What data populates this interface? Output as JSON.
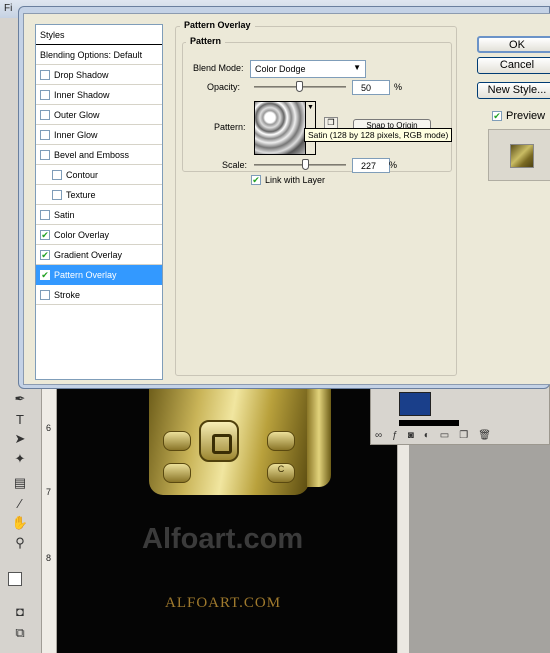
{
  "window": {
    "title": "Fi"
  },
  "dialog": {
    "styles_header": "Styles",
    "blending_options": "Blending Options: Default",
    "layer_styles": [
      {
        "label": "Drop Shadow",
        "checked": false,
        "indent": false
      },
      {
        "label": "Inner Shadow",
        "checked": false,
        "indent": false
      },
      {
        "label": "Outer Glow",
        "checked": false,
        "indent": false
      },
      {
        "label": "Inner Glow",
        "checked": false,
        "indent": false
      },
      {
        "label": "Bevel and Emboss",
        "checked": false,
        "indent": false
      },
      {
        "label": "Contour",
        "checked": false,
        "indent": true
      },
      {
        "label": "Texture",
        "checked": false,
        "indent": true
      },
      {
        "label": "Satin",
        "checked": false,
        "indent": false
      },
      {
        "label": "Color Overlay",
        "checked": true,
        "indent": false
      },
      {
        "label": "Gradient Overlay",
        "checked": true,
        "indent": false
      },
      {
        "label": "Pattern Overlay",
        "checked": true,
        "indent": false,
        "selected": true
      },
      {
        "label": "Stroke",
        "checked": false,
        "indent": false
      }
    ],
    "pattern_overlay": {
      "group_title": "Pattern Overlay",
      "pattern_title": "Pattern",
      "blend_mode_label": "Blend Mode:",
      "blend_mode_value": "Color Dodge",
      "opacity_label": "Opacity:",
      "opacity_value": "50",
      "opacity_fraction": 0.5,
      "percent": "%",
      "pattern_label": "Pattern:",
      "snap_button": "Snap to Origin",
      "tooltip": "Satin (128 by 128 pixels, RGB mode)",
      "scale_label": "Scale:",
      "scale_value": "227",
      "link_label": "Link with Layer",
      "link_checked": true
    },
    "buttons": {
      "ok": "OK",
      "cancel": "Cancel",
      "new_style": "New Style..."
    },
    "preview_label": "Preview",
    "preview_checked": true
  },
  "ruler": {
    "marks": [
      "6",
      "7",
      "8"
    ]
  },
  "canvas": {
    "watermark_large": "Alfoart.com",
    "watermark_small": "ALFOART.COM",
    "phone_keys": [
      "C"
    ]
  },
  "colors": {
    "selection": "#3399ff",
    "checkmark": "#21a121",
    "gold": "#c9b458"
  }
}
